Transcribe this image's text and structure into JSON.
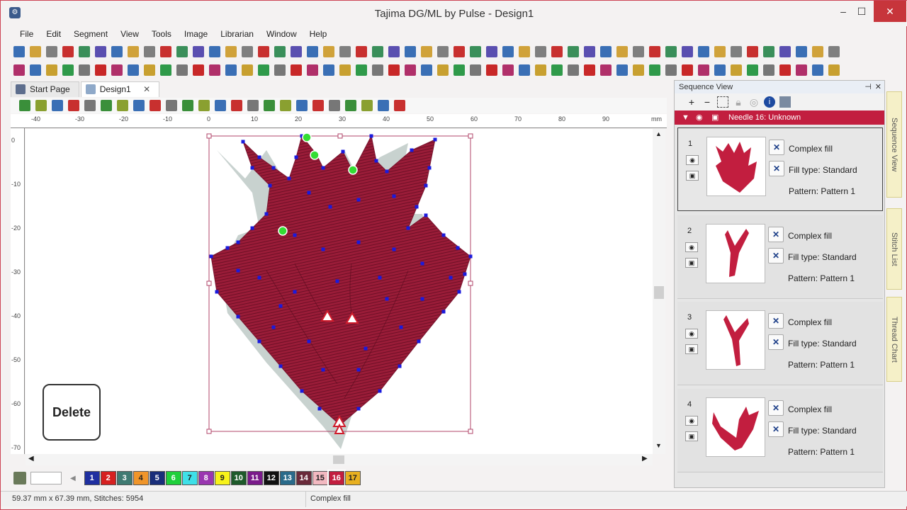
{
  "window": {
    "title": "Tajima DG/ML by Pulse - Design1"
  },
  "menu": [
    "File",
    "Edit",
    "Segment",
    "View",
    "Tools",
    "Image",
    "Librarian",
    "Window",
    "Help"
  ],
  "tabs": [
    {
      "label": "Start Page"
    },
    {
      "label": "Design1",
      "close": "✕"
    }
  ],
  "ruler": {
    "h_unit": "mm",
    "h_ticks": [
      "-40",
      "-30",
      "-20",
      "-10",
      "0",
      "10",
      "20",
      "30",
      "40",
      "50",
      "60",
      "70",
      "80",
      "90"
    ],
    "v_ticks": [
      "0",
      "-10",
      "-20",
      "-30",
      "-40",
      "-50",
      "-60",
      "-70"
    ]
  },
  "overlay": {
    "delete_key": "Delete"
  },
  "thread_colors": [
    {
      "n": "1",
      "bg": "#1f2fa0",
      "fg": "#ffffff"
    },
    {
      "n": "2",
      "bg": "#d62020",
      "fg": "#ffffff"
    },
    {
      "n": "3",
      "bg": "#3f7a72",
      "fg": "#ffffff"
    },
    {
      "n": "4",
      "bg": "#f0952a",
      "fg": "#222222"
    },
    {
      "n": "5",
      "bg": "#1a2e7a",
      "fg": "#ffffff"
    },
    {
      "n": "6",
      "bg": "#1fcf3a",
      "fg": "#ffffff"
    },
    {
      "n": "7",
      "bg": "#3fe0e8",
      "fg": "#222222"
    },
    {
      "n": "8",
      "bg": "#9a36b0",
      "fg": "#ffffff"
    },
    {
      "n": "9",
      "bg": "#f7f21a",
      "fg": "#222222"
    },
    {
      "n": "10",
      "bg": "#1e5a2a",
      "fg": "#ffffff"
    },
    {
      "n": "11",
      "bg": "#7a1a8a",
      "fg": "#ffffff"
    },
    {
      "n": "12",
      "bg": "#111111",
      "fg": "#ffffff"
    },
    {
      "n": "13",
      "bg": "#2a6a8a",
      "fg": "#ffffff"
    },
    {
      "n": "14",
      "bg": "#6a2a3a",
      "fg": "#ffffff"
    },
    {
      "n": "15",
      "bg": "#f2b8c0",
      "fg": "#222222"
    },
    {
      "n": "16",
      "bg": "#c21e3f",
      "fg": "#ffffff"
    },
    {
      "n": "17",
      "bg": "#e8b020",
      "fg": "#222222"
    }
  ],
  "status": {
    "dimensions": "59.37 mm x 67.39 mm, Stitches: 5954",
    "segment_type": "Complex fill"
  },
  "sequence_view": {
    "title": "Sequence View",
    "side_tabs": [
      "Sequence View",
      "Stitch List",
      "Thread Chart"
    ],
    "needle_label": "Needle 16: Unknown",
    "items": [
      {
        "num": "1",
        "type": "Complex fill",
        "fill": "Fill type: Standard",
        "pattern": "Pattern: Pattern  1"
      },
      {
        "num": "2",
        "type": "Complex fill",
        "fill": "Fill type: Standard",
        "pattern": "Pattern: Pattern  1"
      },
      {
        "num": "3",
        "type": "Complex fill",
        "fill": "Fill type: Standard",
        "pattern": "Pattern: Pattern  1"
      },
      {
        "num": "4",
        "type": "Complex fill",
        "fill": "Fill type: Standard",
        "pattern": "Pattern: Pattern  1"
      }
    ]
  },
  "colors": {
    "accent": "#c21e3f",
    "fill": "#9a1c38",
    "points": "#1a1adc",
    "shadow": "#c8d2cf"
  }
}
